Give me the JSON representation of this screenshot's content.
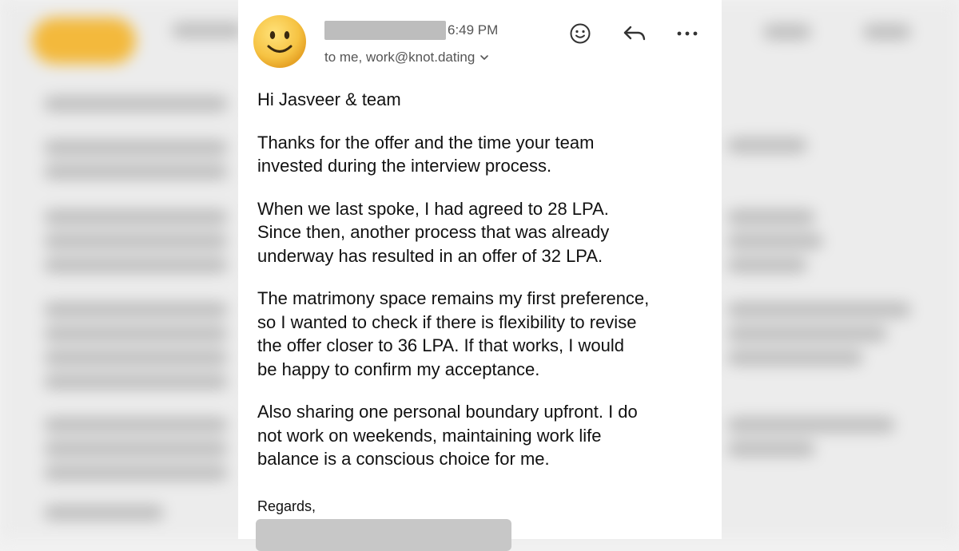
{
  "email": {
    "time": "6:49 PM",
    "recipients": "to me, work@knot.dating",
    "greeting": "Hi Jasveer & team",
    "paragraphs": [
      "Thanks for the offer and the time your team\ninvested during the interview process.",
      "When we last spoke, I had agreed to 28 LPA.\nSince then, another process that was already\nunderway has resulted in an offer of 32 LPA.",
      "The matrimony space remains my first preference,\nso I wanted to check if there is flexibility to revise\nthe offer closer to 36 LPA. If that works, I would\nbe happy to confirm my acceptance.",
      "Also sharing one personal boundary upfront. I do\nnot work on weekends, maintaining work life\nbalance is a conscious choice for me."
    ],
    "signoff": "Regards,"
  },
  "icons": {
    "avatar": "smiling-face-emoji",
    "react": "smiley-icon",
    "reply": "reply-arrow-icon",
    "more": "more-dots-icon",
    "recipients_toggle": "chevron-down-icon"
  },
  "colors": {
    "avatar_yellow": "#f6c343",
    "redaction_gray": "#bdbdbd",
    "meta_text": "#555555"
  }
}
